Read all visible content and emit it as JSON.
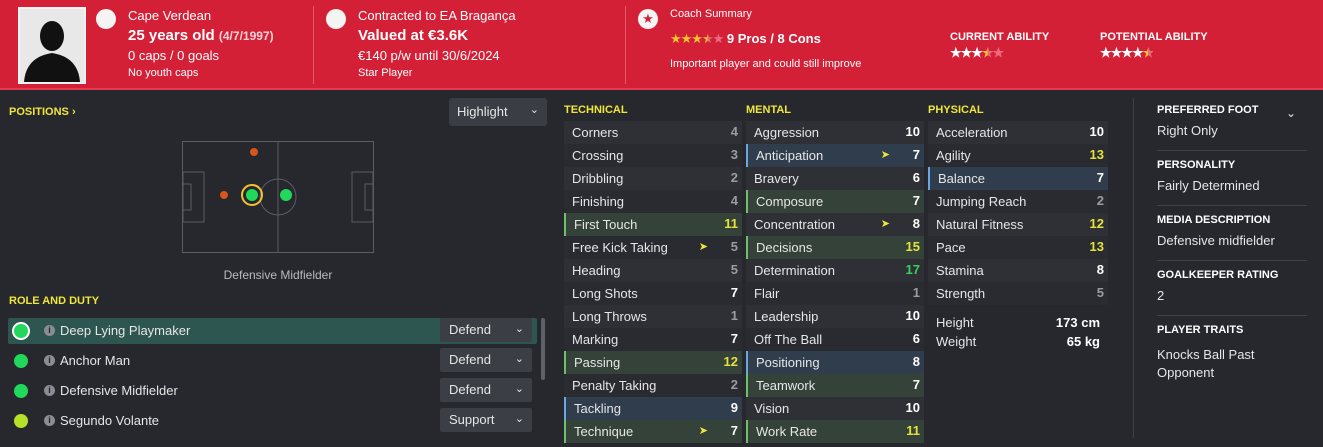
{
  "header": {
    "nationality": "Cape Verdean",
    "age": "25 years old",
    "dob": "(4/7/1997)",
    "caps": "0 caps / 0 goals",
    "youth": "No youth caps",
    "contract": "Contracted to EA Bragança",
    "value": "Valued at €3.6K",
    "wage": "€140 p/w until 30/6/2024",
    "status": "Star Player",
    "coach_title": "Coach Summary",
    "pros_cons": "9 Pros / 8 Cons",
    "coach_note": "Important player and could still improve",
    "ca_label": "CURRENT ABILITY",
    "pa_label": "POTENTIAL ABILITY",
    "coach_stars": 3.5,
    "ca_stars": 3.5,
    "pa_stars": 4.5,
    "accent": "#d42037"
  },
  "positions": {
    "title": "POSITIONS",
    "arrow": "›",
    "highlight": "Highlight",
    "label": "Defensive Midfielder"
  },
  "roles": {
    "title": "ROLE AND DUTY",
    "items": [
      {
        "name": "Deep Lying Playmaker",
        "duty": "Defend",
        "color": "#22d85a"
      },
      {
        "name": "Anchor Man",
        "duty": "Defend",
        "color": "#22d85a"
      },
      {
        "name": "Defensive Midfielder",
        "duty": "Defend",
        "color": "#22d85a"
      },
      {
        "name": "Segundo Volante",
        "duty": "Support",
        "color": "#b6e02a"
      }
    ]
  },
  "technical": {
    "title": "TECHNICAL",
    "attrs": [
      {
        "n": "Corners",
        "v": "4"
      },
      {
        "n": "Crossing",
        "v": "3"
      },
      {
        "n": "Dribbling",
        "v": "2"
      },
      {
        "n": "Finishing",
        "v": "4"
      },
      {
        "n": "First Touch",
        "v": "11"
      },
      {
        "n": "Free Kick Taking",
        "v": "5"
      },
      {
        "n": "Heading",
        "v": "5"
      },
      {
        "n": "Long Shots",
        "v": "7"
      },
      {
        "n": "Long Throws",
        "v": "1"
      },
      {
        "n": "Marking",
        "v": "7"
      },
      {
        "n": "Passing",
        "v": "12"
      },
      {
        "n": "Penalty Taking",
        "v": "2"
      },
      {
        "n": "Tackling",
        "v": "9"
      },
      {
        "n": "Technique",
        "v": "7"
      }
    ]
  },
  "mental": {
    "title": "MENTAL",
    "attrs": [
      {
        "n": "Aggression",
        "v": "10"
      },
      {
        "n": "Anticipation",
        "v": "7"
      },
      {
        "n": "Bravery",
        "v": "6"
      },
      {
        "n": "Composure",
        "v": "7"
      },
      {
        "n": "Concentration",
        "v": "8"
      },
      {
        "n": "Decisions",
        "v": "15"
      },
      {
        "n": "Determination",
        "v": "17"
      },
      {
        "n": "Flair",
        "v": "1"
      },
      {
        "n": "Leadership",
        "v": "10"
      },
      {
        "n": "Off The Ball",
        "v": "6"
      },
      {
        "n": "Positioning",
        "v": "8"
      },
      {
        "n": "Teamwork",
        "v": "7"
      },
      {
        "n": "Vision",
        "v": "10"
      },
      {
        "n": "Work Rate",
        "v": "11"
      }
    ]
  },
  "physical": {
    "title": "PHYSICAL",
    "attrs": [
      {
        "n": "Acceleration",
        "v": "10"
      },
      {
        "n": "Agility",
        "v": "13"
      },
      {
        "n": "Balance",
        "v": "7"
      },
      {
        "n": "Jumping Reach",
        "v": "2"
      },
      {
        "n": "Natural Fitness",
        "v": "12"
      },
      {
        "n": "Pace",
        "v": "13"
      },
      {
        "n": "Stamina",
        "v": "8"
      },
      {
        "n": "Strength",
        "v": "5"
      }
    ],
    "height_label": "Height",
    "height": "173 cm",
    "weight_label": "Weight",
    "weight": "65 kg"
  },
  "info": {
    "foot_label": "PREFERRED FOOT",
    "foot": "Right Only",
    "personality_label": "PERSONALITY",
    "personality": "Fairly Determined",
    "media_label": "MEDIA DESCRIPTION",
    "media": "Defensive midfielder",
    "gk_label": "GOALKEEPER RATING",
    "gk": "2",
    "traits_label": "PLAYER TRAITS",
    "traits": "Knocks Ball Past Opponent"
  }
}
